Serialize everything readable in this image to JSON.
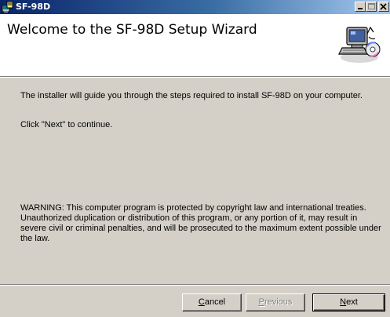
{
  "window": {
    "title": "SF-98D"
  },
  "header": {
    "title": "Welcome to the SF-98D Setup Wizard",
    "icon": "computer-setup-icon"
  },
  "content": {
    "intro": "The installer will guide you through the steps required to install SF-98D on your computer.",
    "continue_hint": "Click \"Next\" to continue.",
    "warning": "WARNING: This computer program is protected by copyright law and international treaties. Unauthorized duplication or distribution of this program, or any portion of it, may result in severe civil or criminal penalties, and will be prosecuted to the maximum extent possible under the law."
  },
  "buttons": {
    "cancel": {
      "mnemonic": "C",
      "rest": "ancel"
    },
    "previous": {
      "mnemonic": "P",
      "rest": "revious",
      "enabled": false
    },
    "next": {
      "mnemonic": "N",
      "rest": "ext"
    }
  },
  "colors": {
    "titlebar_start": "#0a246a",
    "titlebar_end": "#a6caf0",
    "face": "#d4d0c8"
  }
}
